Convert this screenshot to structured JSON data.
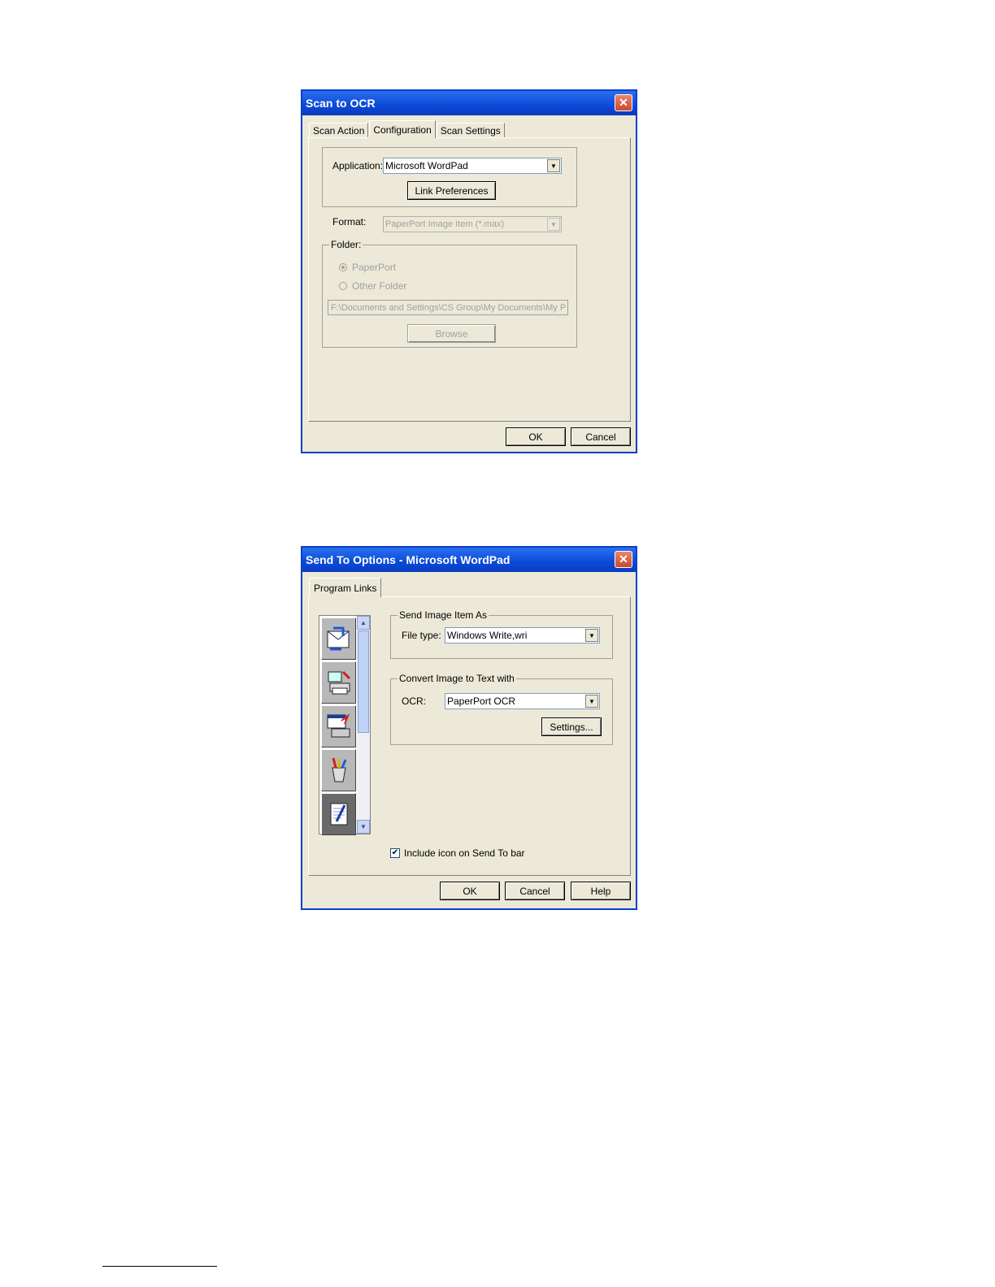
{
  "dialog1": {
    "title": "Scan to OCR",
    "tabs": [
      "Scan Action",
      "Configuration",
      "Scan Settings"
    ],
    "application_label": "Application:",
    "application_value": "Microsoft WordPad",
    "link_preferences_label": "Link Preferences",
    "format_label": "Format:",
    "format_value": "PaperPort Image Item (*.max)",
    "folder_label": "Folder:",
    "radio_paperport": "PaperPort",
    "radio_other": "Other Folder",
    "path_value": "F:\\Documents and Settings\\CS Group\\My Documents\\My P",
    "browse_label": "Browse",
    "ok_label": "OK",
    "cancel_label": "Cancel"
  },
  "dialog2": {
    "title": "Send To Options - Microsoft WordPad",
    "tab": "Program Links",
    "send_group_label": "Send Image Item As",
    "filetype_label": "File type:",
    "filetype_value": "Windows Write,wri",
    "convert_group_label": "Convert Image to Text with",
    "ocr_label": "OCR:",
    "ocr_value": "PaperPort OCR",
    "settings_label": "Settings...",
    "include_icon_label": "Include icon on Send To bar",
    "include_icon_checked": true,
    "ok_label": "OK",
    "cancel_label": "Cancel",
    "help_label": "Help"
  },
  "colors": {
    "titlebar": "#0a4ad8",
    "dialog_bg": "#ece9d8",
    "close_button": "#d0452a"
  }
}
